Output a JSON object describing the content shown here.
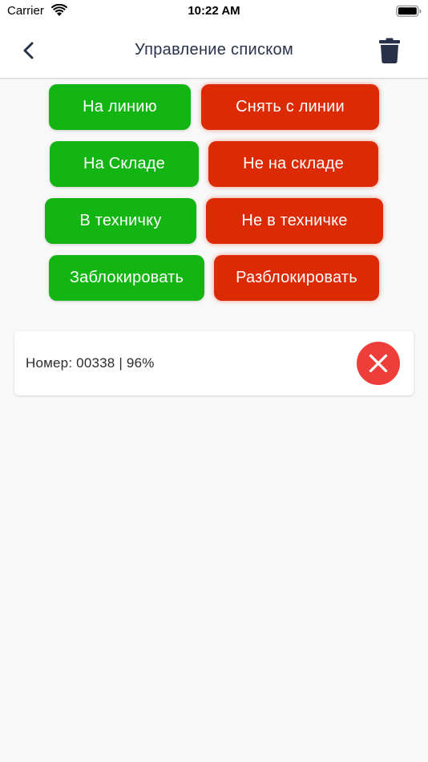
{
  "status_bar": {
    "carrier": "Carrier",
    "time": "10:22 AM"
  },
  "nav": {
    "title": "Управление списком",
    "back_icon": "chevron-left-icon",
    "delete_icon": "trash-icon"
  },
  "actions": {
    "to_line": "На линию",
    "off_line": "Снять с линии",
    "in_stock": "На Складе",
    "not_in_stock": "Не на складе",
    "to_service": "В техничку",
    "not_in_service": "Не в техничке",
    "block": "Заблокировать",
    "unblock": "Разблокировать"
  },
  "items": [
    {
      "text": "Номер: 00338 | 96%",
      "remove_icon": "close-icon"
    }
  ],
  "colors": {
    "green": "#13b513",
    "red": "#db2a04",
    "remove": "#ef3e3a",
    "nav_icon": "#27324a"
  }
}
